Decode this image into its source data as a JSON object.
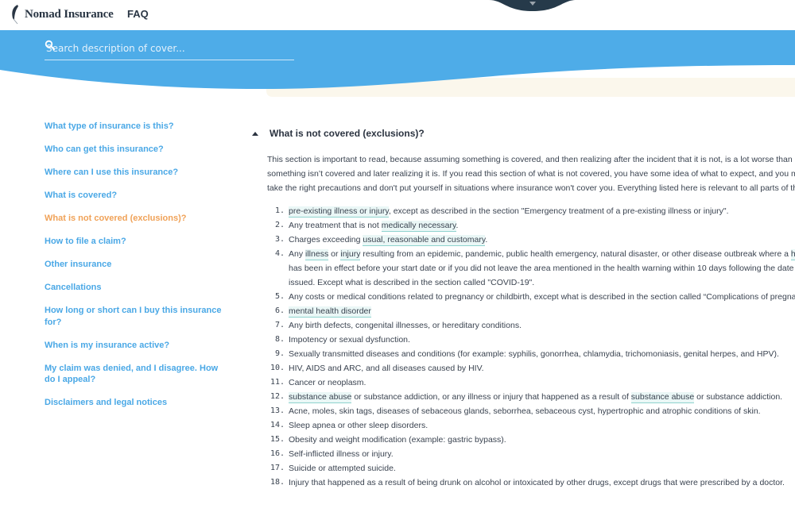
{
  "header": {
    "brand": "Nomad Insurance",
    "logo_icon": "feather-icon",
    "nav_faq": "FAQ",
    "dropdown_icon": "caret-down-icon"
  },
  "search": {
    "placeholder": "Search description of cover...",
    "value": "",
    "icon": "search-icon"
  },
  "colors": {
    "hero_blue": "#4eace8",
    "cream": "#fbf7ec",
    "link_blue": "#4aa8e6",
    "active_orange": "#f0a258",
    "term_highlight": "#eaf7f6",
    "term_underline": "#8fd3cf",
    "dark_navy": "#263a4a"
  },
  "sidebar": {
    "items": [
      {
        "label": "What type of insurance is this?",
        "active": false
      },
      {
        "label": "Who can get this insurance?",
        "active": false
      },
      {
        "label": "Where can I use this insurance?",
        "active": false
      },
      {
        "label": "What is covered?",
        "active": false
      },
      {
        "label": "What is not covered (exclusions)?",
        "active": true
      },
      {
        "label": "How to file a claim?",
        "active": false
      },
      {
        "label": "Other insurance",
        "active": false
      },
      {
        "label": "Cancellations",
        "active": false
      },
      {
        "label": "How long or short can I buy this insurance for?",
        "active": false
      },
      {
        "label": "When is my insurance active?",
        "active": false
      },
      {
        "label": "My claim was denied, and I disagree. How do I appeal?",
        "active": false
      },
      {
        "label": "Disclaimers and legal notices",
        "active": false
      }
    ]
  },
  "main": {
    "section_title": "What is not covered (exclusions)?",
    "section_expanded": true,
    "intro": "This section is important to read, because assuming something is covered, and then realizing after the incident that it is not, is a lot worse than assuming something isn’t covered and later realizing it is. If you read this section of what is not covered, you have some idea of what to expect, and you make sure you take the right precautions and don't put yourself in situations where insurance won't cover you. Everything listed here is relevant to all parts of the coverage.",
    "exclusions": [
      {
        "num": "1.",
        "parts": [
          {
            "t": "pre-existing illness or injury",
            "term": true
          },
          {
            "t": ", except as described in the section \"Emergency treatment of a pre-existing illness or injury\"."
          }
        ]
      },
      {
        "num": "2.",
        "parts": [
          {
            "t": "Any treatment that is not "
          },
          {
            "t": "medically necessary",
            "term": true
          },
          {
            "t": "."
          }
        ]
      },
      {
        "num": "3.",
        "parts": [
          {
            "t": "Charges exceeding "
          },
          {
            "t": "usual, reasonable and customary",
            "term": true
          },
          {
            "t": "."
          }
        ]
      },
      {
        "num": "4.",
        "parts": [
          {
            "t": "Any "
          },
          {
            "t": "illness",
            "term": true
          },
          {
            "t": " or "
          },
          {
            "t": "injury",
            "term": true
          },
          {
            "t": " resulting from an epidemic, pandemic, public health emergency, natural disaster, or other disease outbreak where a "
          },
          {
            "t": "health warning",
            "term": true
          },
          {
            "t": " has been in effect before your start date or if you did not leave the area mentioned in the health warning within 10 days following the date the warning is issued. Except what is described in the section called \"COVID-19\"."
          }
        ]
      },
      {
        "num": "5.",
        "parts": [
          {
            "t": "Any costs or medical conditions related to pregnancy or childbirth, except what is described in the section called “Complications of pregnancy”."
          }
        ]
      },
      {
        "num": "6.",
        "parts": [
          {
            "t": "mental health disorder",
            "term": true
          }
        ]
      },
      {
        "num": "7.",
        "parts": [
          {
            "t": "Any birth defects, congenital illnesses, or hereditary conditions."
          }
        ]
      },
      {
        "num": "8.",
        "parts": [
          {
            "t": "Impotency or sexual dysfunction."
          }
        ]
      },
      {
        "num": "9.",
        "parts": [
          {
            "t": "Sexually transmitted diseases and conditions (for example: syphilis, gonorrhea, chlamydia, trichomoniasis, genital herpes, and HPV)."
          }
        ]
      },
      {
        "num": "10.",
        "parts": [
          {
            "t": "HIV, AIDS and ARC, and all diseases caused by HIV."
          }
        ]
      },
      {
        "num": "11.",
        "parts": [
          {
            "t": "Cancer or neoplasm."
          }
        ]
      },
      {
        "num": "12.",
        "parts": [
          {
            "t": "substance abuse",
            "term": true
          },
          {
            "t": " or substance addiction, or any illness or injury that happened as a result of "
          },
          {
            "t": "substance abuse",
            "term": true
          },
          {
            "t": " or substance addiction."
          }
        ]
      },
      {
        "num": "13.",
        "parts": [
          {
            "t": "Acne, moles, skin tags, diseases of sebaceous glands, seborrhea, sebaceous cyst, hypertrophic and atrophic conditions of skin."
          }
        ]
      },
      {
        "num": "14.",
        "parts": [
          {
            "t": "Sleep apnea or other sleep disorders."
          }
        ]
      },
      {
        "num": "15.",
        "parts": [
          {
            "t": "Obesity and weight modification (example: gastric bypass)."
          }
        ]
      },
      {
        "num": "16.",
        "parts": [
          {
            "t": "Self-inflicted illness or injury."
          }
        ]
      },
      {
        "num": "17.",
        "parts": [
          {
            "t": "Suicide or attempted suicide."
          }
        ]
      },
      {
        "num": "18.",
        "parts": [
          {
            "t": "Injury that happened as a result of being drunk on alcohol or intoxicated by other drugs, except drugs that were prescribed by a doctor."
          }
        ]
      }
    ]
  }
}
